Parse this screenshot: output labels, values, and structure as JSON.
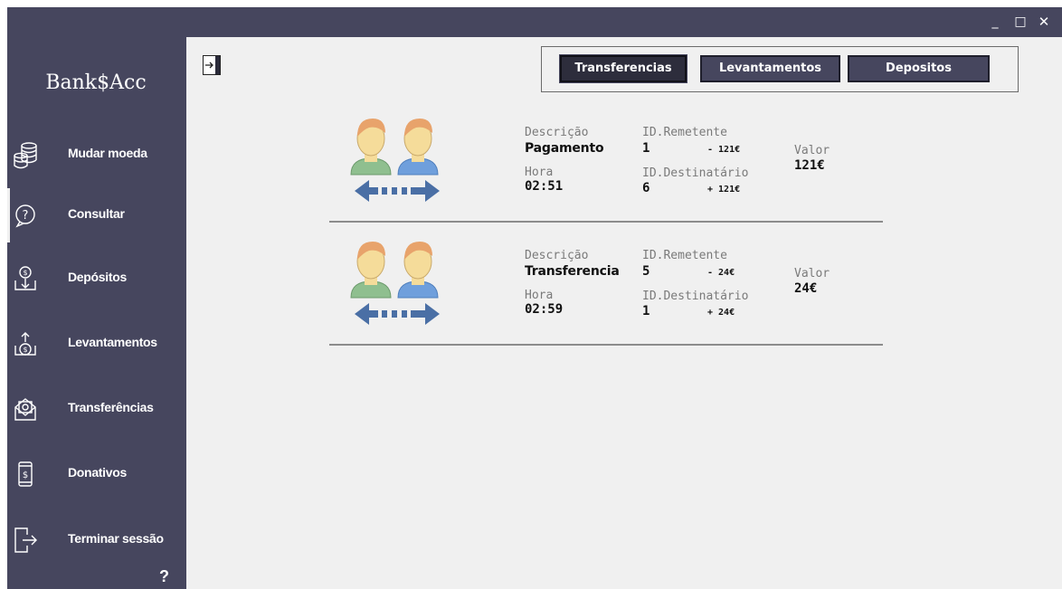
{
  "window": {
    "controls": {
      "minimize": "_",
      "maximize": "□",
      "close": "✕"
    }
  },
  "sidebar": {
    "logo": "Bank$Acc",
    "items": [
      {
        "label": "Mudar moeda",
        "icon": "coins-stack-icon"
      },
      {
        "label": "Consultar",
        "icon": "question-circle-icon"
      },
      {
        "label": "Depósitos",
        "icon": "deposit-coin-icon"
      },
      {
        "label": "Levantamentos",
        "icon": "withdraw-coin-icon"
      },
      {
        "label": "Transferências",
        "icon": "money-envelope-icon"
      },
      {
        "label": "Donativos",
        "icon": "phone-dollar-icon"
      },
      {
        "label": "Terminar sessão",
        "icon": "logout-icon"
      }
    ],
    "active_index": 1,
    "help": "?"
  },
  "tabs": [
    {
      "label": "Transferencias",
      "selected": true
    },
    {
      "label": "Levantamentos",
      "selected": false
    },
    {
      "label": "Depositos",
      "selected": false
    }
  ],
  "labels": {
    "description": "Descrição",
    "hour": "Hora",
    "sender": "ID.Remetente",
    "recipient": "ID.Destinatário",
    "value": "Valor"
  },
  "transactions": [
    {
      "description": "Pagamento",
      "hour": "02:51",
      "sender_id": "1",
      "sender_amount": "- 121€",
      "recipient_id": "6",
      "recipient_amount": "+ 121€",
      "value": "121€"
    },
    {
      "description": "Transferencia",
      "hour": "02:59",
      "sender_id": "5",
      "sender_amount": "- 24€",
      "recipient_id": "1",
      "recipient_amount": "+ 24€",
      "value": "24€"
    }
  ],
  "colors": {
    "sidebar": "#46465e",
    "background": "#f0f0f0",
    "arrow": "#4a6fa5",
    "person_left_shirt": "#8fbf8f",
    "person_right_shirt": "#6f9fdc",
    "skin": "#f5dc9a",
    "hair": "#e8a36b"
  }
}
